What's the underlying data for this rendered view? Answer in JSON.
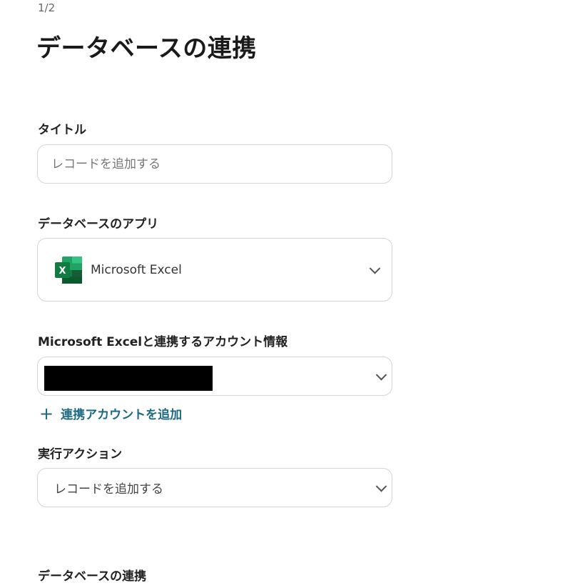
{
  "header": {
    "step": "1/2",
    "title": "データベースの連携"
  },
  "form": {
    "title_field": {
      "label": "タイトル",
      "placeholder": "レコードを追加する"
    },
    "app_field": {
      "label": "データベースのアプリ",
      "value": "Microsoft Excel",
      "icon": "microsoft-excel-icon"
    },
    "account_field": {
      "label": "Microsoft Excelと連携するアカウント情報",
      "value_redacted": true
    },
    "add_account_label": "連携アカウントを追加",
    "action_field": {
      "label": "実行アクション",
      "value": "レコードを追加する"
    },
    "section_heading": "データベースの連携"
  },
  "colors": {
    "accent_link": "#1d6b82",
    "excel_dark_green": "#107c41",
    "excel_light_green": "#33c481",
    "border": "#d4d4d4"
  }
}
